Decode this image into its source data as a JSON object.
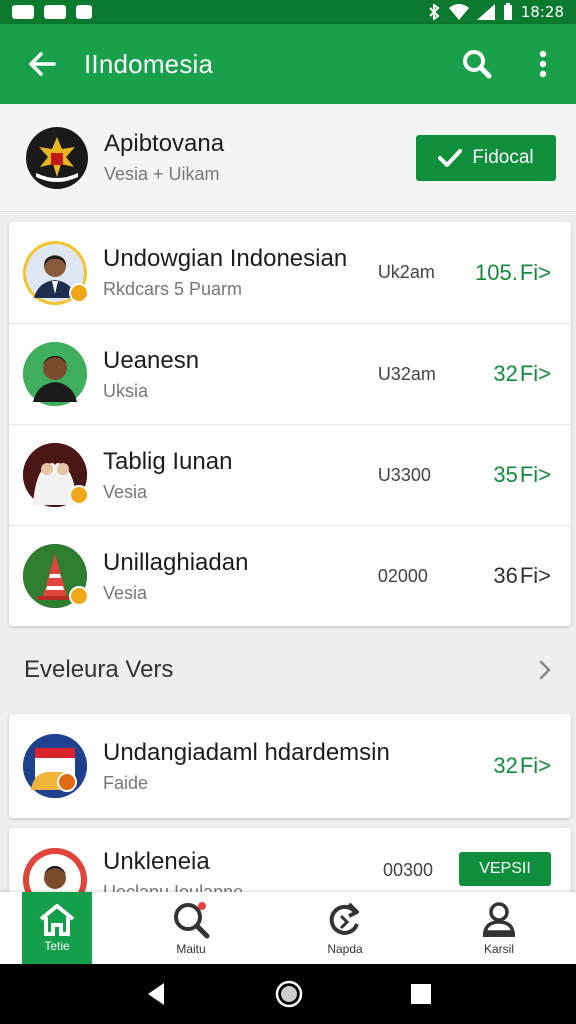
{
  "status_bar": {
    "time": "18:28"
  },
  "app_bar": {
    "title": "IIndomesia"
  },
  "header": {
    "title": "Apibtovana",
    "subtitle": "Vesia + Uikam",
    "follow_label": "Fidocal"
  },
  "list_top": [
    {
      "title": "Undowgian Indonesian",
      "subtitle": "Rkdcars 5 Puarm",
      "meta": "Uk2am",
      "count": "105.",
      "count_color": "green"
    },
    {
      "title": "Ueanesn",
      "subtitle": "Uksia",
      "meta": "U32am",
      "count": "32",
      "count_color": "green"
    },
    {
      "title": "Tablig Iunan",
      "subtitle": "Vesia",
      "meta": "U3300",
      "count": "35",
      "count_color": "green"
    },
    {
      "title": "Unillaghiadan",
      "subtitle": "Vesia",
      "meta": "02000",
      "count": "36",
      "count_color": "dark"
    }
  ],
  "arrow_label": "Fi>",
  "section": {
    "title": "Eveleura Vers"
  },
  "list_bottom": [
    {
      "title": "Undangiadaml hdardemsin",
      "subtitle": "Faide",
      "count": "32"
    }
  ],
  "partial_item": {
    "title": "Unkleneia",
    "subtitle": "Ueclanu Ioulanne",
    "meta": "00300",
    "button_label": "VEPSII"
  },
  "bottom_nav": [
    {
      "label": "Tetie",
      "icon": "home-icon"
    },
    {
      "label": "Maitu",
      "icon": "search-icon"
    },
    {
      "label": "Napda",
      "icon": "refresh-icon"
    },
    {
      "label": "Karsil",
      "icon": "profile-icon"
    }
  ],
  "colors": {
    "primary": "#18a14a",
    "primary_dark": "#0b7a2e",
    "accent_green": "#138a3c",
    "badge_orange": "#f0a81a"
  }
}
